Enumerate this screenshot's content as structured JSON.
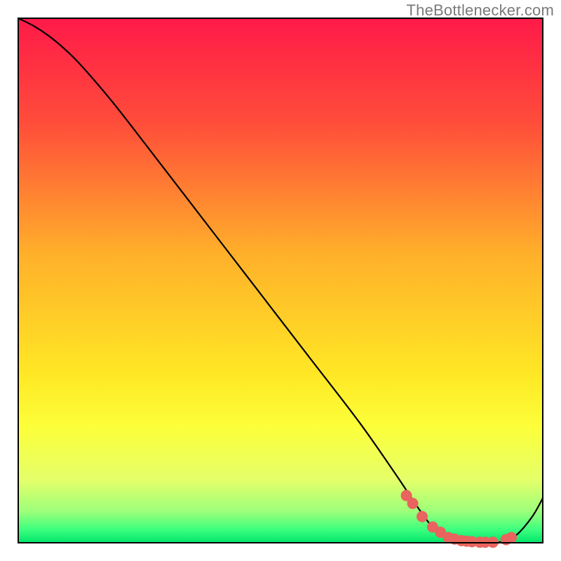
{
  "attribution": "TheBottlenecker.com",
  "chart_data": {
    "type": "line",
    "title": "",
    "xlabel": "",
    "ylabel": "",
    "xlim": [
      0,
      100
    ],
    "ylim": [
      0,
      100
    ],
    "gradient_stops": [
      {
        "offset": 0.0,
        "color": "#ff1a49"
      },
      {
        "offset": 0.2,
        "color": "#ff4d3a"
      },
      {
        "offset": 0.45,
        "color": "#ffb02a"
      },
      {
        "offset": 0.68,
        "color": "#ffe825"
      },
      {
        "offset": 0.78,
        "color": "#fcff3a"
      },
      {
        "offset": 0.88,
        "color": "#e5ff6a"
      },
      {
        "offset": 0.94,
        "color": "#9dff7a"
      },
      {
        "offset": 0.975,
        "color": "#3cff7e"
      },
      {
        "offset": 1.0,
        "color": "#00e56b"
      }
    ],
    "curve": {
      "x": [
        0.0,
        3.0,
        6.0,
        9.0,
        12.0,
        18.0,
        25.0,
        35.0,
        45.0,
        55.0,
        65.0,
        72.0,
        76.0,
        79.0,
        82.0,
        86.0,
        90.0,
        92.5,
        95.0,
        98.0,
        100.0
      ],
      "y": [
        100.0,
        98.5,
        96.5,
        94.0,
        91.0,
        84.0,
        75.0,
        62.0,
        49.0,
        36.0,
        23.0,
        13.0,
        7.0,
        3.0,
        1.0,
        0.2,
        0.0,
        0.3,
        1.5,
        5.0,
        8.5
      ]
    },
    "dots": {
      "x": [
        74.0,
        75.2,
        77.0,
        79.0,
        80.5,
        82.0,
        83.2,
        84.5,
        85.5,
        86.5,
        88.0,
        89.0,
        90.5,
        93.0,
        94.0
      ],
      "y": [
        9.0,
        7.5,
        5.0,
        3.0,
        2.0,
        1.0,
        0.7,
        0.4,
        0.3,
        0.2,
        0.1,
        0.1,
        0.1,
        0.6,
        1.0
      ]
    },
    "dot_color": "#e9645e",
    "dot_radius": 8
  },
  "plot": {
    "left": 26,
    "top": 26,
    "size": 748
  }
}
